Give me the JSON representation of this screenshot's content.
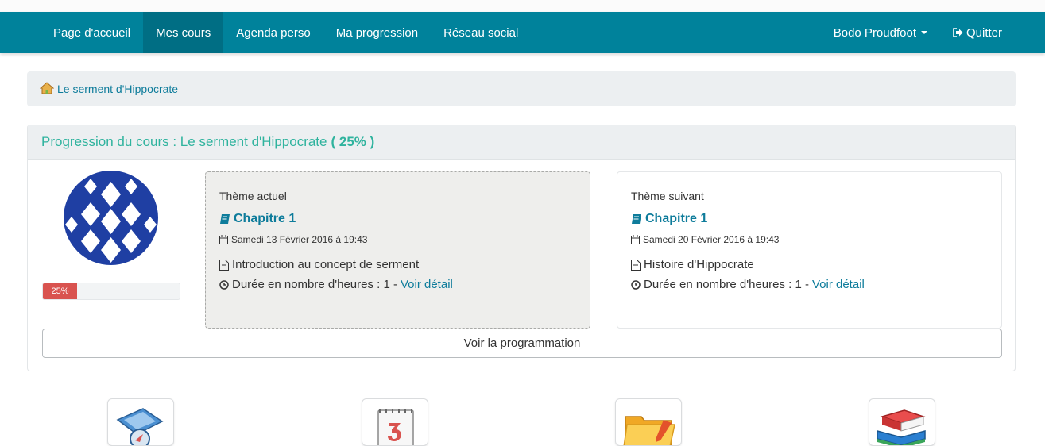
{
  "nav": {
    "items": [
      {
        "label": "Page d'accueil"
      },
      {
        "label": "Mes cours"
      },
      {
        "label": "Agenda perso"
      },
      {
        "label": "Ma progression"
      },
      {
        "label": "Réseau social"
      }
    ],
    "user": "Bodo Proudfoot",
    "logout": "Quitter"
  },
  "breadcrumb": {
    "label": "Le serment d'Hippocrate"
  },
  "progress": {
    "title": "Progression du cours : Le serment d'Hippocrate",
    "percent_text": "( 25% )",
    "bar_label": "25%",
    "bar_value": 25
  },
  "current_theme": {
    "label": "Thème actuel",
    "chapter": "Chapitre 1",
    "date": "Samedi 13 Février 2016 à 19:43",
    "description": "Introduction au concept de serment",
    "duration": "Durée en nombre d'heures : 1 -",
    "detail_link": "Voir détail"
  },
  "next_theme": {
    "label": "Thème suivant",
    "chapter": "Chapitre 1",
    "date": "Samedi 20 Février 2016 à 19:43",
    "description": "Histoire d'Hippocrate",
    "duration": "Durée en nombre d'heures : 1 -",
    "detail_link": "Voir détail"
  },
  "program_button": "Voir la programmation",
  "colors": {
    "navbar": "#00829b",
    "accent": "#2fb39e",
    "link": "#0e7c9b",
    "progress": "#d9534f"
  }
}
